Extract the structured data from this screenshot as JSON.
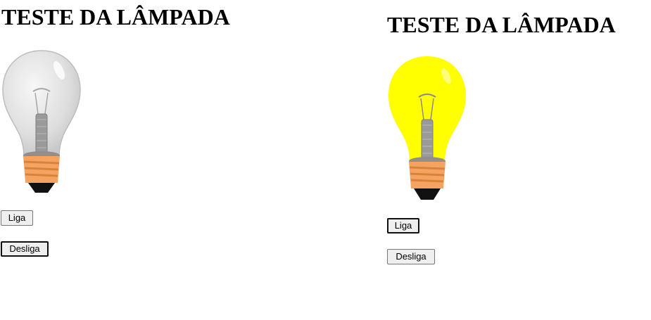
{
  "panels": [
    {
      "id": "off",
      "title": "TESTE DA LÂMPADA",
      "bulb_state": "off",
      "bulb_color": "#e6e6e6",
      "buttons": {
        "on_label": "Liga",
        "off_label": "Desliga",
        "focused": "off"
      }
    },
    {
      "id": "on",
      "title": "TESTE DA LÂMPADA",
      "bulb_state": "on",
      "bulb_color": "#ffff00",
      "buttons": {
        "on_label": "Liga",
        "off_label": "Desliga",
        "focused": "on"
      }
    }
  ],
  "colors": {
    "base_orange": "#f4a460",
    "base_tip": "#111111",
    "filament": "#9a9a9a"
  }
}
